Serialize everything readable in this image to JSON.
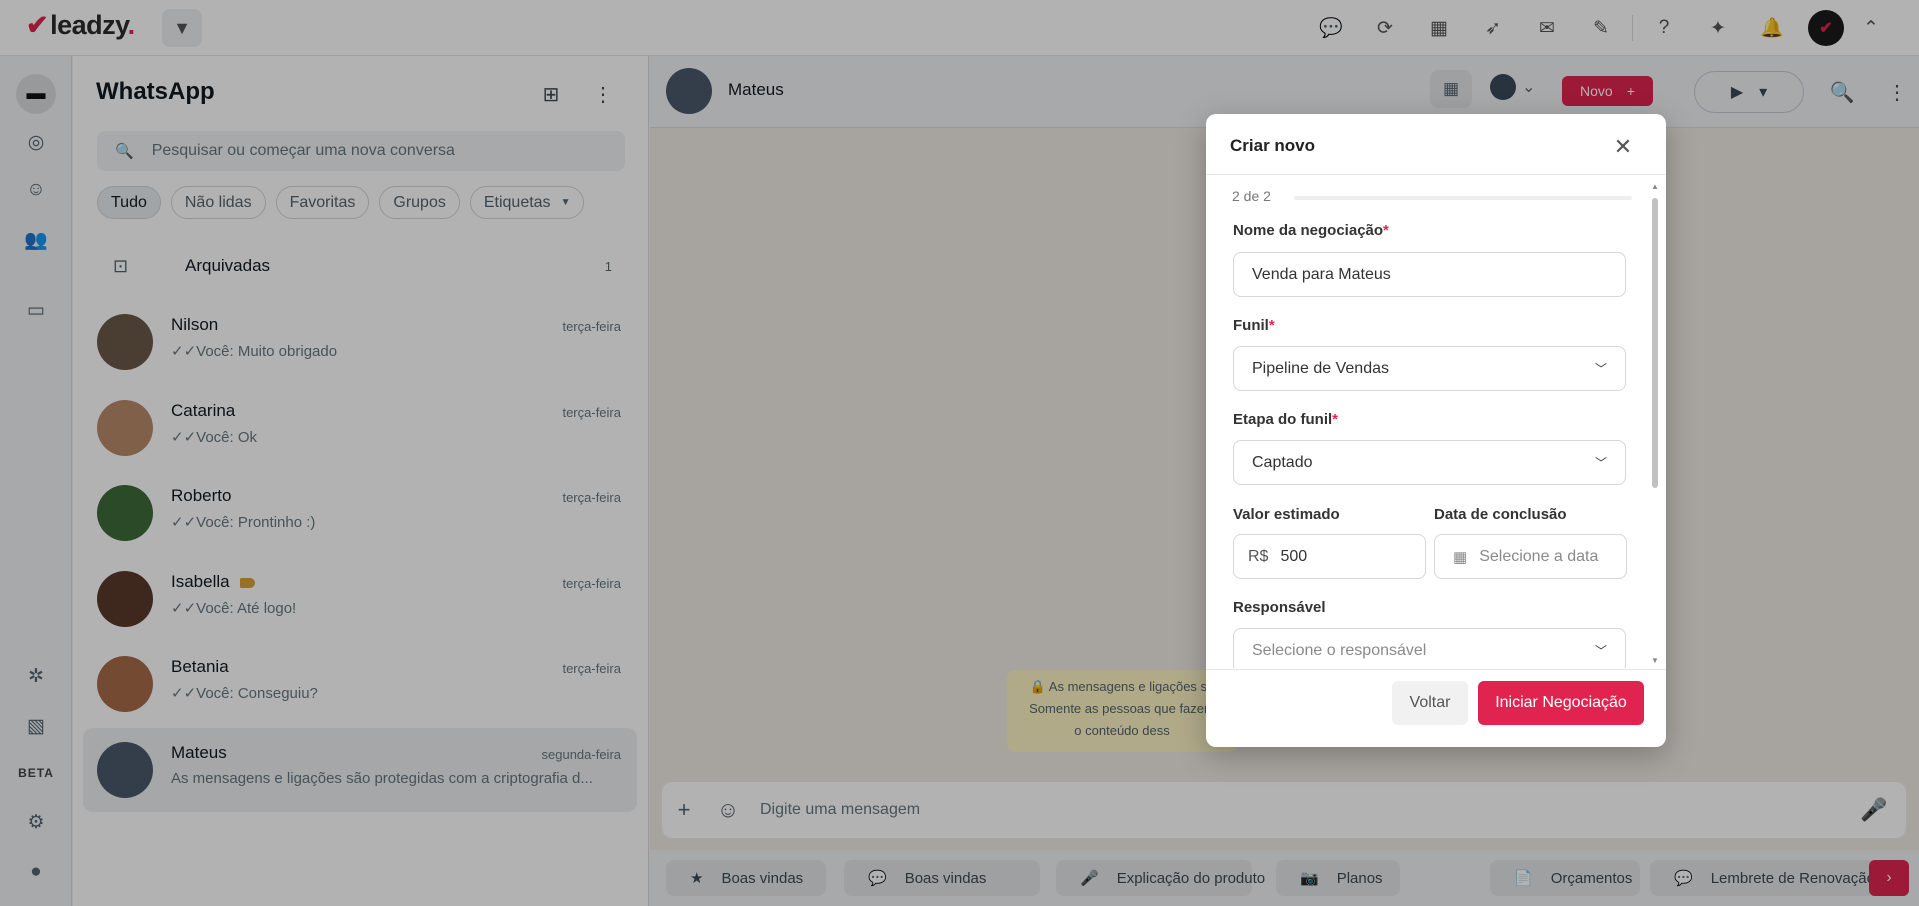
{
  "brand": {
    "name": "leadzy",
    "tick": "✔",
    "dot": "."
  },
  "topbar": {
    "icons": [
      "chat-bubbles-icon",
      "sync-icon",
      "calendar-icon",
      "rocket-icon",
      "comment-icon",
      "pen-icon",
      "help-icon",
      "sparkles-icon",
      "bell-icon"
    ]
  },
  "rail": {
    "beta_label": "BETA"
  },
  "chatlist": {
    "title": "WhatsApp",
    "search_placeholder": "Pesquisar ou começar uma nova conversa",
    "filters": [
      "Tudo",
      "Não lidas",
      "Favoritas",
      "Grupos",
      "Etiquetas"
    ],
    "archived": {
      "label": "Arquivadas",
      "count": "1"
    },
    "chats": [
      {
        "name": "Nilson",
        "time": "terça-feira",
        "message": "Você: Muito obrigado",
        "avatar_color": "#6b5a4a"
      },
      {
        "name": "Catarina",
        "time": "terça-feira",
        "message": "Você: Ok",
        "avatar_color": "#b98a6a"
      },
      {
        "name": "Roberto",
        "time": "terça-feira",
        "message": "Você: Prontinho :)",
        "avatar_color": "#3d6b3a"
      },
      {
        "name": "Isabella",
        "time": "terça-feira",
        "message": "Você: Até logo!",
        "avatar_color": "#5a3a2a"
      },
      {
        "name": "Betania",
        "time": "terça-feira",
        "message": "Você: Conseguiu?",
        "avatar_color": "#a86a4a"
      },
      {
        "name": "Mateus",
        "time": "segunda-feira",
        "message": "As mensagens e ligações são protegidas com a criptografia d...",
        "avatar_color": "#4a5a6a"
      }
    ]
  },
  "conversation": {
    "contact_name": "Mateus",
    "novo_label": "Novo",
    "encryption_lines": [
      "🔒 As mensagens e ligações sã",
      "Somente as pessoas que fazem",
      "o conteúdo dess"
    ],
    "composer_placeholder": "Digite uma mensagem",
    "quick_replies": [
      {
        "label": "Boas vindas",
        "icon": "★"
      },
      {
        "label": "Boas vindas",
        "icon": "💬"
      },
      {
        "label": "Explicação do produto",
        "icon": "🎤"
      },
      {
        "label": "Planos",
        "icon": "📷"
      },
      {
        "label": "Orçamentos",
        "icon": "📄"
      },
      {
        "label": "Lembrete de Renovação d",
        "icon": "💬"
      }
    ]
  },
  "modal": {
    "title": "Criar novo",
    "step": "2 de 2",
    "deal_name_label": "Nome da negociação",
    "deal_name_value": "Venda para Mateus",
    "funnel_label": "Funil",
    "funnel_value": "Pipeline de Vendas",
    "stage_label": "Etapa do funil",
    "stage_value": "Captado",
    "value_label": "Valor estimado",
    "currency": "R$",
    "value": "500",
    "date_label": "Data de conclusão",
    "date_placeholder": "Selecione a data",
    "owner_label": "Responsável",
    "owner_placeholder": "Selecione o responsável",
    "back_label": "Voltar",
    "start_label": "Iniciar Negociação",
    "required_mark": "*"
  },
  "colors": {
    "accent": "#e0244f",
    "panel": "#ffffff",
    "chat_bg": "#efeae2"
  }
}
